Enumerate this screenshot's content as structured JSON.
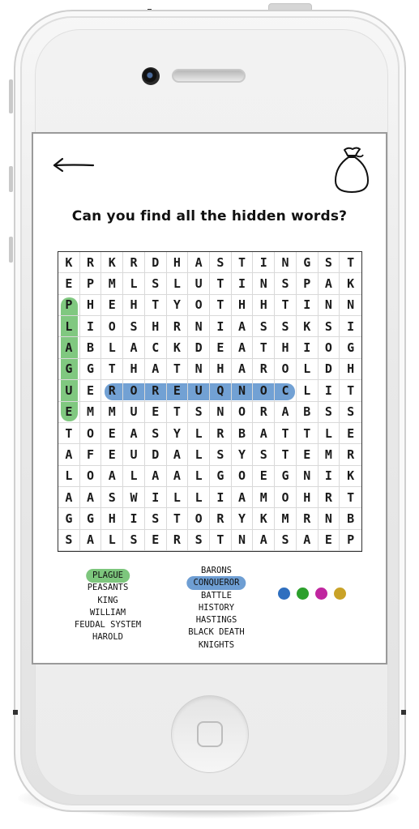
{
  "app": {
    "prompt": "Can you find all the hidden words?",
    "back_icon": "arrow-left-icon",
    "bag_icon": "money-bag-icon"
  },
  "grid": {
    "rows": [
      [
        "K",
        "R",
        "K",
        "R",
        "D",
        "H",
        "A",
        "S",
        "T",
        "I",
        "N",
        "G",
        "S",
        "T"
      ],
      [
        "E",
        "P",
        "M",
        "L",
        "S",
        "L",
        "U",
        "T",
        "I",
        "N",
        "S",
        "P",
        "A",
        "K"
      ],
      [
        "P",
        "H",
        "E",
        "H",
        "T",
        "Y",
        "O",
        "T",
        "H",
        "H",
        "T",
        "I",
        "N",
        "N"
      ],
      [
        "L",
        "I",
        "O",
        "S",
        "H",
        "R",
        "N",
        "I",
        "A",
        "S",
        "S",
        "K",
        "S",
        "I"
      ],
      [
        "A",
        "B",
        "L",
        "A",
        "C",
        "K",
        "D",
        "E",
        "A",
        "T",
        "H",
        "I",
        "O",
        "G"
      ],
      [
        "G",
        "G",
        "T",
        "H",
        "A",
        "T",
        "N",
        "H",
        "A",
        "R",
        "O",
        "L",
        "D",
        "H"
      ],
      [
        "U",
        "E",
        "R",
        "O",
        "R",
        "E",
        "U",
        "Q",
        "N",
        "O",
        "C",
        "L",
        "I",
        "T"
      ],
      [
        "E",
        "M",
        "M",
        "U",
        "E",
        "T",
        "S",
        "N",
        "O",
        "R",
        "A",
        "B",
        "S",
        "S"
      ],
      [
        "T",
        "O",
        "E",
        "A",
        "S",
        "Y",
        "L",
        "R",
        "B",
        "A",
        "T",
        "T",
        "L",
        "E"
      ],
      [
        "A",
        "F",
        "E",
        "U",
        "D",
        "A",
        "L",
        "S",
        "Y",
        "S",
        "T",
        "E",
        "M",
        "R"
      ],
      [
        "L",
        "O",
        "A",
        "L",
        "A",
        "A",
        "L",
        "G",
        "O",
        "E",
        "G",
        "N",
        "I",
        "K"
      ],
      [
        "A",
        "A",
        "S",
        "W",
        "I",
        "L",
        "L",
        "I",
        "A",
        "M",
        "O",
        "H",
        "R",
        "T"
      ],
      [
        "G",
        "G",
        "H",
        "I",
        "S",
        "T",
        "O",
        "R",
        "Y",
        "K",
        "M",
        "R",
        "N",
        "B"
      ],
      [
        "S",
        "A",
        "L",
        "S",
        "E",
        "R",
        "S",
        "T",
        "N",
        "A",
        "S",
        "A",
        "E",
        "P"
      ]
    ],
    "found": [
      {
        "word": "PLAGUE",
        "color": "#5cb85c"
      },
      {
        "word": "CONQUEROR",
        "color": "#4a86c8"
      }
    ]
  },
  "word_lists": {
    "left": [
      "PLAGUE",
      "PEASANTS",
      "KING",
      "WILLIAM",
      "FEUDAL SYSTEM",
      "HAROLD"
    ],
    "right": [
      "BARONS",
      "CONQUEROR",
      "BATTLE",
      "HISTORY",
      "HASTINGS",
      "BLACK DEATH",
      "KNIGHTS"
    ]
  },
  "colors": {
    "found_green": "#5cb85c",
    "found_blue": "#4a86c8",
    "palette": [
      {
        "name": "blue",
        "hex": "#2f6fbf"
      },
      {
        "name": "green",
        "hex": "#2ca02c"
      },
      {
        "name": "magenta",
        "hex": "#c0269f"
      },
      {
        "name": "gold",
        "hex": "#c9a227"
      }
    ]
  }
}
